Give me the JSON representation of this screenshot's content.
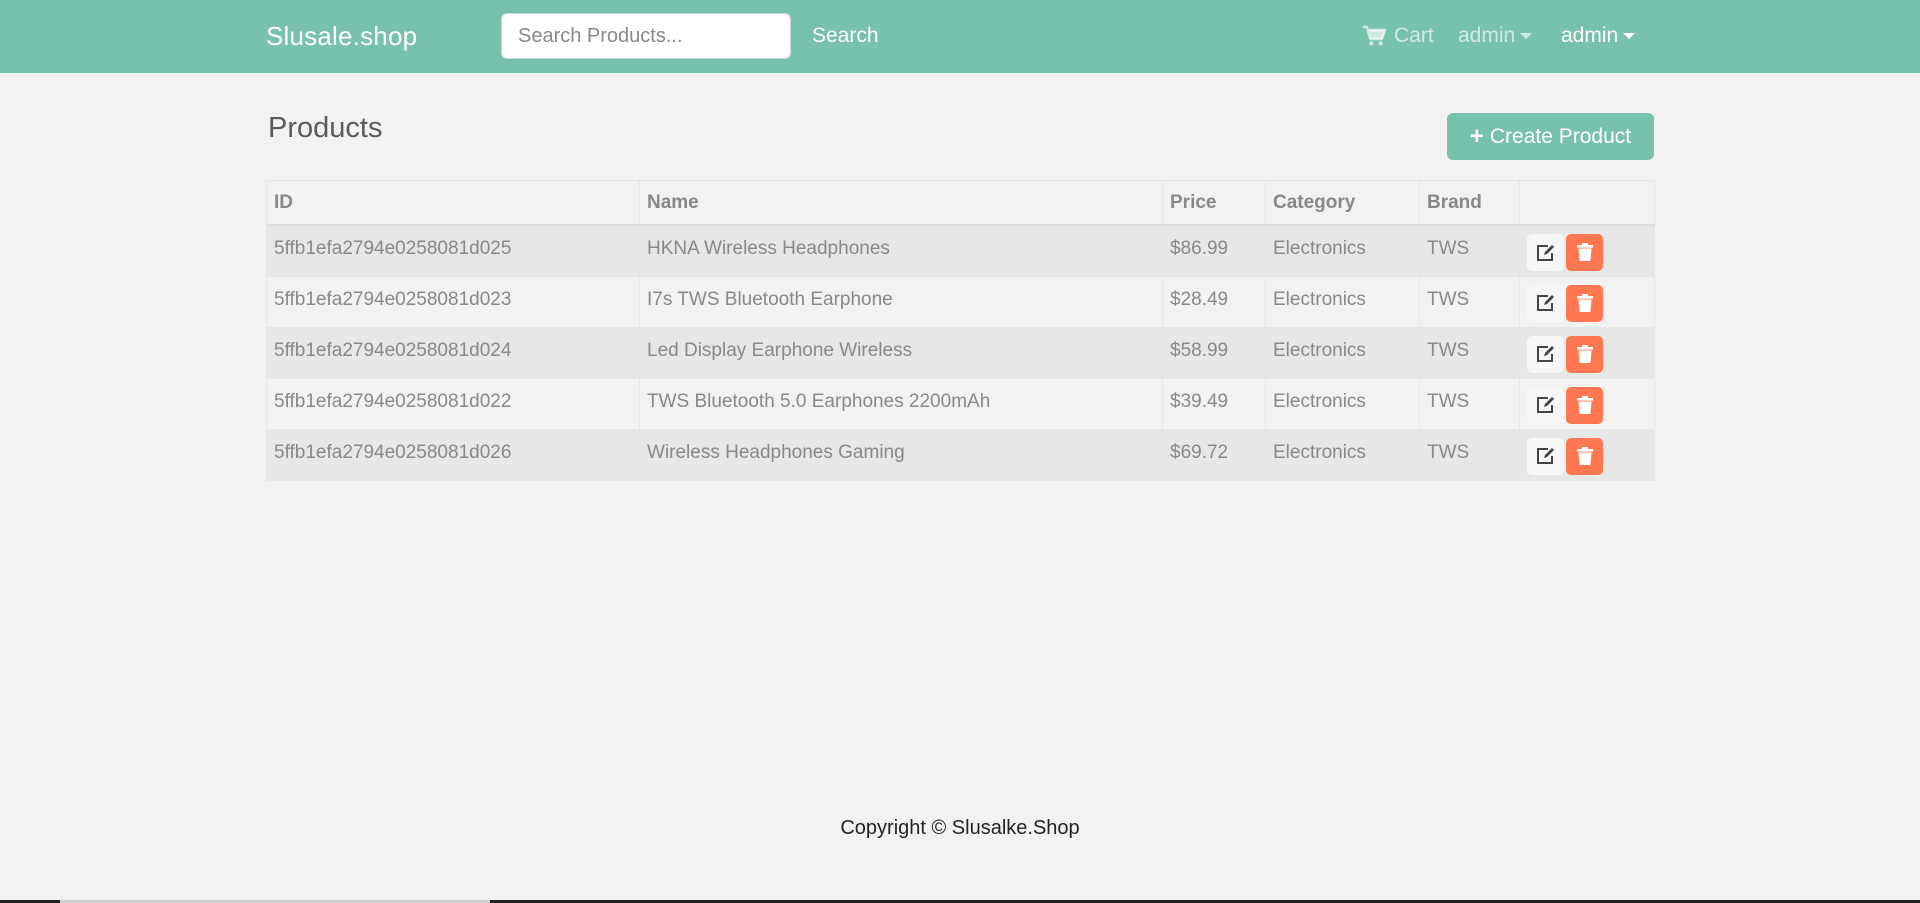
{
  "navbar": {
    "brand": "Slusale.shop",
    "search_placeholder": "Search Products...",
    "search_button": "Search",
    "cart_label": "Cart",
    "cart_icon": "shopping-cart-icon",
    "admin_menu_1": "admin",
    "admin_menu_2": "admin",
    "colors": {
      "background": "#78c2ad",
      "text": "#ffffff"
    }
  },
  "page": {
    "title": "Products",
    "create_button": "Create Product",
    "create_icon": "plus-icon"
  },
  "table": {
    "headers": [
      "ID",
      "Name",
      "Price",
      "Category",
      "Brand",
      ""
    ],
    "rows": [
      {
        "id": "5ffb1efa2794e0258081d025",
        "name": "HKNA Wireless Headphones",
        "price": "$86.99",
        "category": "Electronics",
        "brand": "TWS"
      },
      {
        "id": "5ffb1efa2794e0258081d023",
        "name": "I7s TWS Bluetooth Earphone",
        "price": "$28.49",
        "category": "Electronics",
        "brand": "TWS"
      },
      {
        "id": "5ffb1efa2794e0258081d024",
        "name": "Led Display Earphone Wireless",
        "price": "$58.99",
        "category": "Electronics",
        "brand": "TWS"
      },
      {
        "id": "5ffb1efa2794e0258081d022",
        "name": "TWS Bluetooth 5.0 Earphones 2200mAh",
        "price": "$39.49",
        "category": "Electronics",
        "brand": "TWS"
      },
      {
        "id": "5ffb1efa2794e0258081d026",
        "name": "Wireless Headphones Gaming",
        "price": "$69.72",
        "category": "Electronics",
        "brand": "TWS"
      }
    ],
    "row_actions": {
      "edit_icon": "edit-icon",
      "delete_icon": "trash-icon"
    },
    "colors": {
      "delete": "#ff7851",
      "striped_row": "#e7e7e7"
    }
  },
  "footer": {
    "copyright": "Copyright © Slusalke.Shop"
  }
}
